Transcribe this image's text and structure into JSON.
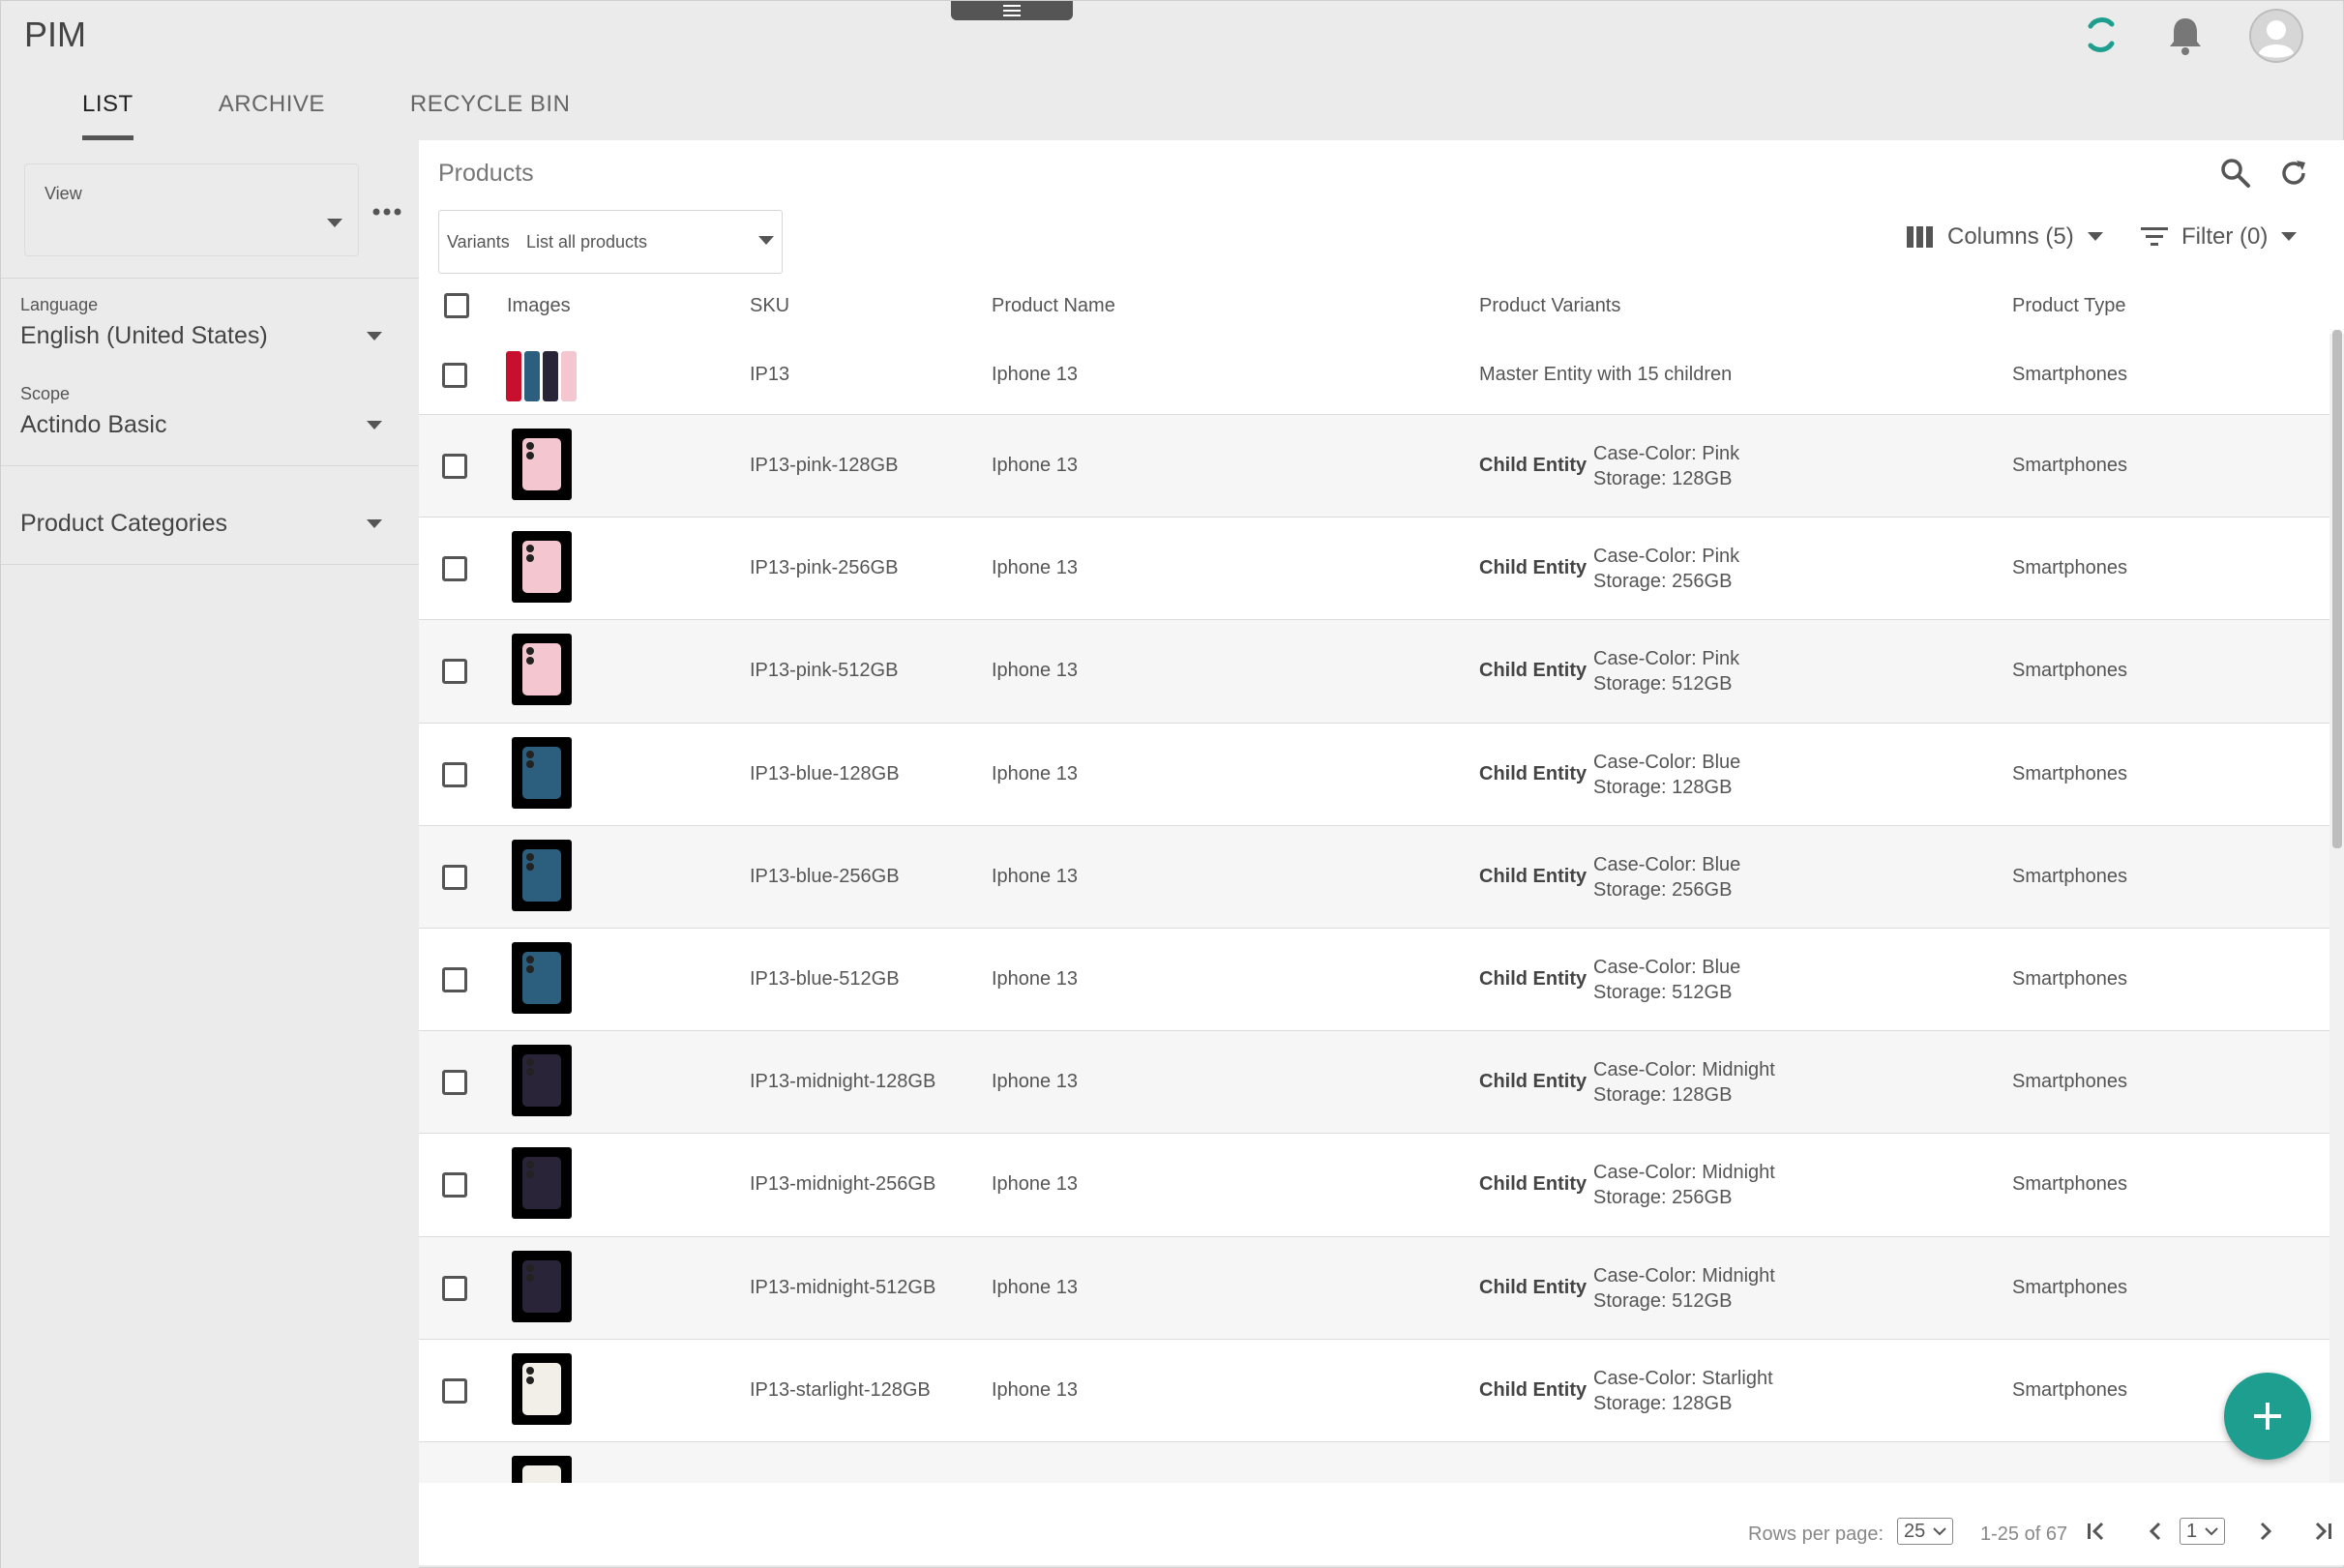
{
  "app": {
    "title": "PIM",
    "accent": "#1e9e8e"
  },
  "tabs": [
    {
      "label": "LIST",
      "active": true
    },
    {
      "label": "ARCHIVE",
      "active": false
    },
    {
      "label": "RECYCLE BIN",
      "active": false
    }
  ],
  "sidebar": {
    "view_label": "View",
    "view_value": "",
    "language_label": "Language",
    "language_value": "English (United States)",
    "scope_label": "Scope",
    "scope_value": "Actindo Basic",
    "categories_label": "Product Categories"
  },
  "main": {
    "title": "Products",
    "variants_label": "Variants",
    "variants_value": "List all products",
    "columns_label": "Columns (5)",
    "filter_label": "Filter (0)"
  },
  "table": {
    "headers": {
      "images": "Images",
      "sku": "SKU",
      "name": "Product Name",
      "variants": "Product Variants",
      "type": "Product Type"
    },
    "master": {
      "sku": "IP13",
      "name": "Iphone 13",
      "variants": "Master Entity with 15 children",
      "type": "Smartphones"
    },
    "rows": [
      {
        "sku": "IP13-pink-128GB",
        "name": "Iphone 13",
        "entity": "Child Entity",
        "color": "Case-Color: Pink",
        "storage": "Storage: 128GB",
        "type": "Smartphones",
        "phone_color": "#f4c6cf"
      },
      {
        "sku": "IP13-pink-256GB",
        "name": "Iphone 13",
        "entity": "Child Entity",
        "color": "Case-Color: Pink",
        "storage": "Storage: 256GB",
        "type": "Smartphones",
        "phone_color": "#f4c6cf"
      },
      {
        "sku": "IP13-pink-512GB",
        "name": "Iphone 13",
        "entity": "Child Entity",
        "color": "Case-Color: Pink",
        "storage": "Storage: 512GB",
        "type": "Smartphones",
        "phone_color": "#f4c6cf"
      },
      {
        "sku": "IP13-blue-128GB",
        "name": "Iphone 13",
        "entity": "Child Entity",
        "color": "Case-Color: Blue",
        "storage": "Storage: 128GB",
        "type": "Smartphones",
        "phone_color": "#2c5e7d"
      },
      {
        "sku": "IP13-blue-256GB",
        "name": "Iphone 13",
        "entity": "Child Entity",
        "color": "Case-Color: Blue",
        "storage": "Storage: 256GB",
        "type": "Smartphones",
        "phone_color": "#2c5e7d"
      },
      {
        "sku": "IP13-blue-512GB",
        "name": "Iphone 13",
        "entity": "Child Entity",
        "color": "Case-Color: Blue",
        "storage": "Storage: 512GB",
        "type": "Smartphones",
        "phone_color": "#2c5e7d"
      },
      {
        "sku": "IP13-midnight-128GB",
        "name": "Iphone 13",
        "entity": "Child Entity",
        "color": "Case-Color: Midnight",
        "storage": "Storage: 128GB",
        "type": "Smartphones",
        "phone_color": "#2a2438"
      },
      {
        "sku": "IP13-midnight-256GB",
        "name": "Iphone 13",
        "entity": "Child Entity",
        "color": "Case-Color: Midnight",
        "storage": "Storage: 256GB",
        "type": "Smartphones",
        "phone_color": "#2a2438"
      },
      {
        "sku": "IP13-midnight-512GB",
        "name": "Iphone 13",
        "entity": "Child Entity",
        "color": "Case-Color: Midnight",
        "storage": "Storage: 512GB",
        "type": "Smartphones",
        "phone_color": "#2a2438"
      },
      {
        "sku": "IP13-starlight-128GB",
        "name": "Iphone 13",
        "entity": "Child Entity",
        "color": "Case-Color: Starlight",
        "storage": "Storage: 128GB",
        "type": "Smartphones",
        "phone_color": "#f2efe8"
      }
    ]
  },
  "pagination": {
    "rows_per_page_label": "Rows per page:",
    "rows_per_page_value": "25",
    "range": "1-25 of 67",
    "page_value": "1"
  }
}
